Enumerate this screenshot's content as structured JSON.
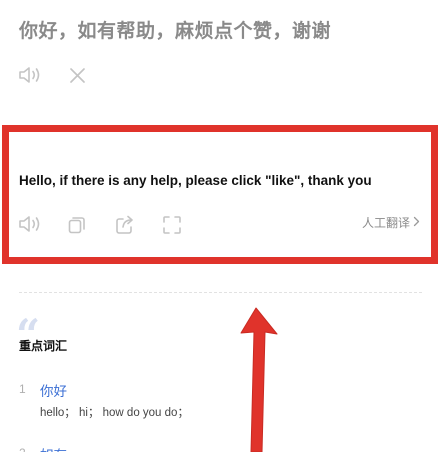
{
  "source": {
    "text": "你好，如有帮助，麻烦点个赞，谢谢"
  },
  "translation": {
    "text": "Hello, if there is any help, please click \"like\", thank you",
    "human_translate_label": "人工翻译"
  },
  "vocab": {
    "heading": "重点词汇",
    "items": [
      {
        "num": "1",
        "word": "你好",
        "definition": "hello； hi； how do you do；"
      },
      {
        "num": "2",
        "word": "如有"
      }
    ]
  },
  "colors": {
    "highlight": "#e0332b",
    "link": "#3b6fd4",
    "muted": "#8a8a8a"
  },
  "icons": {
    "source_actions": [
      "speaker-icon",
      "close-icon"
    ],
    "translation_actions": [
      "speaker-icon",
      "copy-icon",
      "share-icon",
      "fullscreen-icon"
    ]
  }
}
